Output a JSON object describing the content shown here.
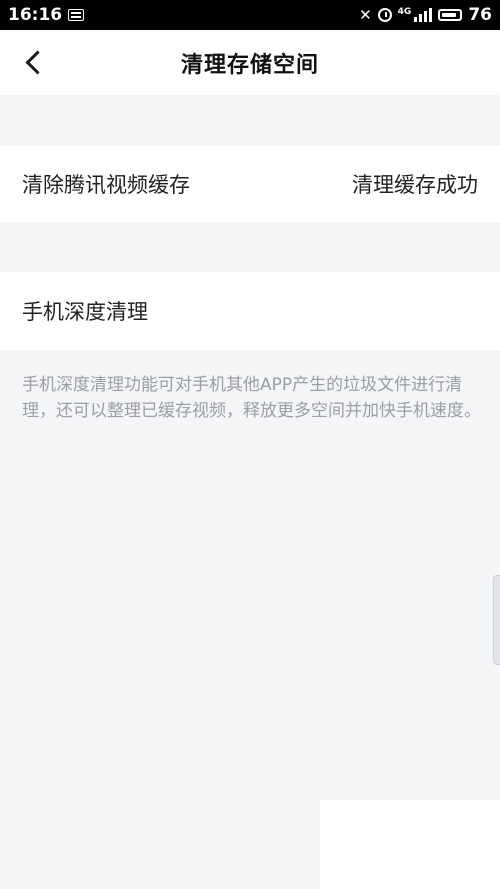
{
  "status_bar": {
    "time": "16:16",
    "network": "4G",
    "battery": "76",
    "icons": [
      "news-icon",
      "muted-notification-icon",
      "alarm-icon",
      "signal-icon",
      "battery-icon"
    ]
  },
  "header": {
    "title": "清理存储空间",
    "back_icon": "chevron-left-icon"
  },
  "rows": {
    "cache": {
      "label": "清除腾讯视频缓存",
      "status": "清理缓存成功"
    },
    "deep_clean": {
      "label": "手机深度清理"
    }
  },
  "description": "手机深度清理功能可对手机其他APP产生的垃圾文件进行清理，还可以整理已缓存视频，释放更多空间并加快手机速度。",
  "colors": {
    "background": "#f4f5f7",
    "card": "#ffffff",
    "text_primary": "#222222",
    "text_secondary": "#9b9ea5",
    "status_bar": "#000000"
  }
}
